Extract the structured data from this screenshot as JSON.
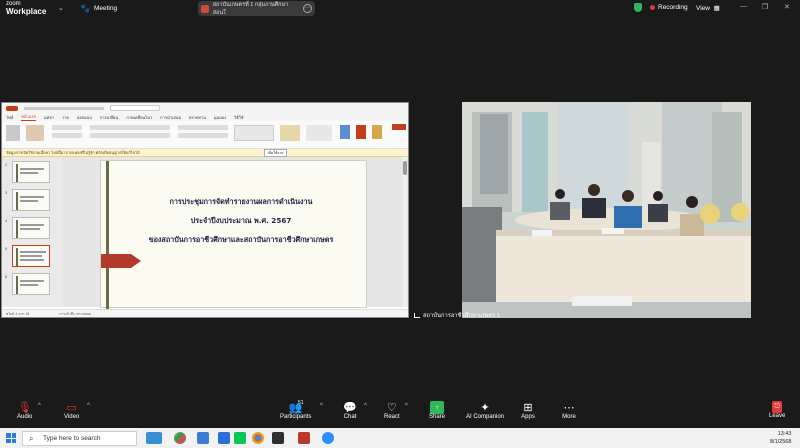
{
  "app": {
    "logo_line1": "zoom",
    "logo_line2": "Workplace",
    "meeting_label": "Meeting",
    "share_tab_title": "สถาบันเกษตรที่ 1 กลุ่มงานศึกษา สอนใ",
    "recording_label": "Recording",
    "view_label": "View"
  },
  "powerpoint": {
    "menu": [
      "ไฟล์",
      "หน้าแรก",
      "แทรก",
      "วาด",
      "ออกแบบ",
      "การเปลี่ยน",
      "ภาพเคลื่อนไหว",
      "การนำเสนอ",
      "ตรวจทาน",
      "มุมมอง",
      "วิธีใช้"
    ],
    "active_menu_index": 1,
    "warning_text": "ข้อมูลการเปิดใช้งานเนื้อหา ไฟล์นี้มาจากแหล่งที่ไม่รู้จัก คลิกเพื่ออนุญาตให้แก้ไขได้",
    "warning_button": "เปิดใช้งาน",
    "slide_lines": [
      "การประชุมการจัดทำรายงานผลการดำเนินงาน",
      "ประจำปีงบประมาณ พ.ศ. 2567",
      "ของสถาบันการอาชีวศึกษาและสถาบันการอาชีวศึกษาเกษตร"
    ],
    "thumb_numbers": [
      "2",
      "3",
      "4",
      "5",
      "6"
    ],
    "status_left": "สไลด์ 4 จาก 19",
    "status_mid": "การเข้าถึง: ตรวจสอบ"
  },
  "video": {
    "participant_name": "สถาบันการอาชีวศึกษาเกษตร 1"
  },
  "toolbar": {
    "audio": "Audio",
    "video": "Video",
    "participants": "Participants",
    "participants_count": "51",
    "chat": "Chat",
    "react": "React",
    "share": "Share",
    "ai_companion": "AI Companion",
    "apps": "Apps",
    "more": "More",
    "leave": "Leave"
  },
  "taskbar": {
    "search_placeholder": "Type here to search",
    "time": "13:43",
    "date": "8/1/2568"
  },
  "colors": {
    "share_green": "#2fb85a",
    "record_red": "#e23b3b",
    "pp_accent": "#c43e1c",
    "slide_title": "#1f1f4a"
  }
}
